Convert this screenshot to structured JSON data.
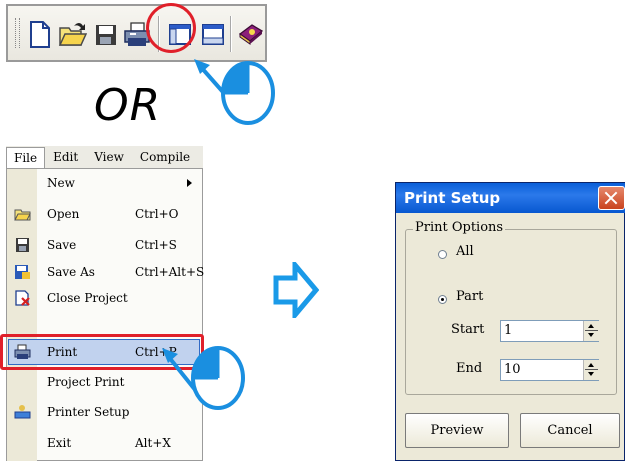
{
  "connector_text": "OR",
  "toolbar": {
    "buttons": [
      {
        "name": "new-file"
      },
      {
        "name": "open-folder"
      },
      {
        "name": "save"
      },
      {
        "name": "print"
      },
      {
        "name": "window-layout"
      },
      {
        "name": "window-layout-2"
      },
      {
        "name": "help-book"
      }
    ],
    "highlighted": "print"
  },
  "menubar": {
    "items": [
      "File",
      "Edit",
      "View",
      "Compile"
    ]
  },
  "file_menu": {
    "items": [
      {
        "label": "New",
        "shortcut": "",
        "submenu": true
      },
      {
        "label": "Open",
        "shortcut": "Ctrl+O"
      },
      {
        "label": "Save",
        "shortcut": "Ctrl+S"
      },
      {
        "label": "Save As",
        "shortcut": "Ctrl+Alt+S"
      },
      {
        "label": "Close Project",
        "shortcut": ""
      },
      {
        "label": "Print",
        "shortcut": "Ctrl+P"
      },
      {
        "label": "Project Print",
        "shortcut": ""
      },
      {
        "label": "Printer Setup",
        "shortcut": ""
      },
      {
        "label": "Exit",
        "shortcut": "Alt+X"
      }
    ],
    "highlighted": "Print"
  },
  "dialog": {
    "title": "Print Setup",
    "group_label": "Print Options",
    "option_all": "All",
    "option_part": "Part",
    "selected_option": "Part",
    "start_label": "Start",
    "start_value": "1",
    "end_label": "End",
    "end_value": "10",
    "preview_button": "Preview",
    "cancel_button": "Cancel"
  },
  "colors": {
    "highlight_ring": "#e0202a",
    "pointer_blue": "#1a8fe0",
    "title_bar": "#0a5fd8"
  }
}
